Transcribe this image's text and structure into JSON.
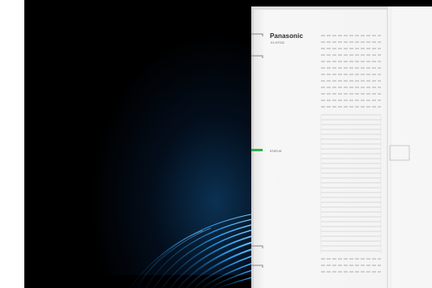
{
  "device": {
    "brand": "Panasonic",
    "model": "KX-HTS32",
    "status_label": "STATUS",
    "status_led_color": "#2fb24a"
  },
  "colors": {
    "background": "#000000",
    "glow": "#1e90ff",
    "panel": "#f4f4f4"
  }
}
